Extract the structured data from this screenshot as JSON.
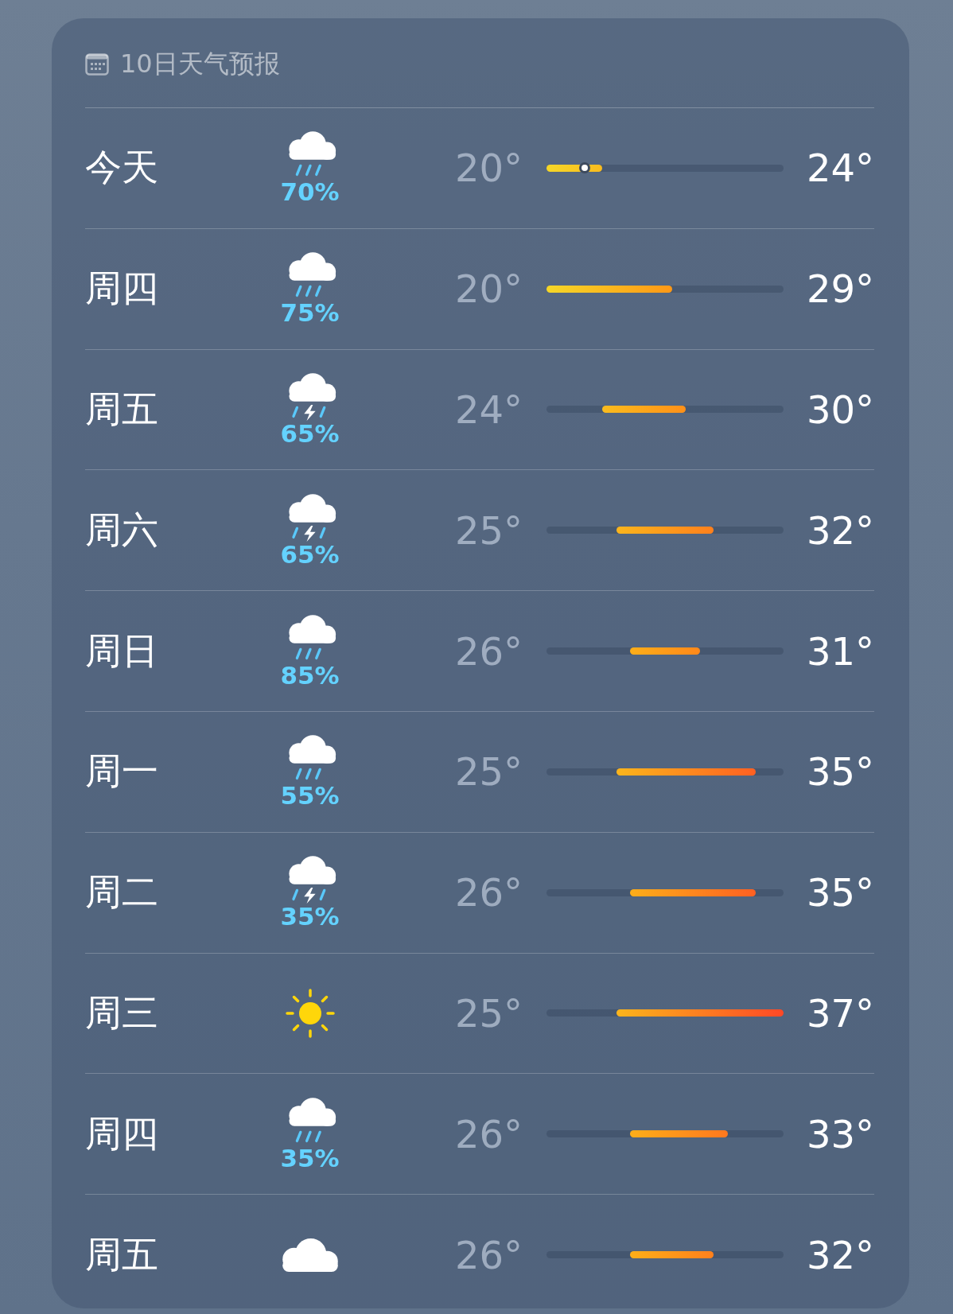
{
  "header": {
    "title": "10日天气预报"
  },
  "days": [
    {
      "day": "今天",
      "kind": "rain",
      "precip": "70%",
      "low": "20°",
      "high": "24°",
      "current": {
        "level": 0.16
      }
    },
    {
      "day": "周四",
      "kind": "rain",
      "precip": "75%",
      "low": "20°",
      "high": "29°"
    },
    {
      "day": "周五",
      "kind": "thunder",
      "precip": "65%",
      "low": "24°",
      "high": "30°"
    },
    {
      "day": "周六",
      "kind": "thunder",
      "precip": "65%",
      "low": "25°",
      "high": "32°"
    },
    {
      "day": "周日",
      "kind": "rain",
      "precip": "85%",
      "low": "26°",
      "high": "31°"
    },
    {
      "day": "周一",
      "kind": "rain",
      "precip": "55%",
      "low": "25°",
      "high": "35°"
    },
    {
      "day": "周二",
      "kind": "thunder",
      "precip": "35%",
      "low": "26°",
      "high": "35°"
    },
    {
      "day": "周三",
      "kind": "sun",
      "low": "25°",
      "high": "37°"
    },
    {
      "day": "周四",
      "kind": "rain",
      "precip": "35%",
      "low": "26°",
      "high": "33°"
    },
    {
      "day": "周五",
      "kind": "cloud",
      "low": "26°",
      "high": "32°"
    }
  ]
}
